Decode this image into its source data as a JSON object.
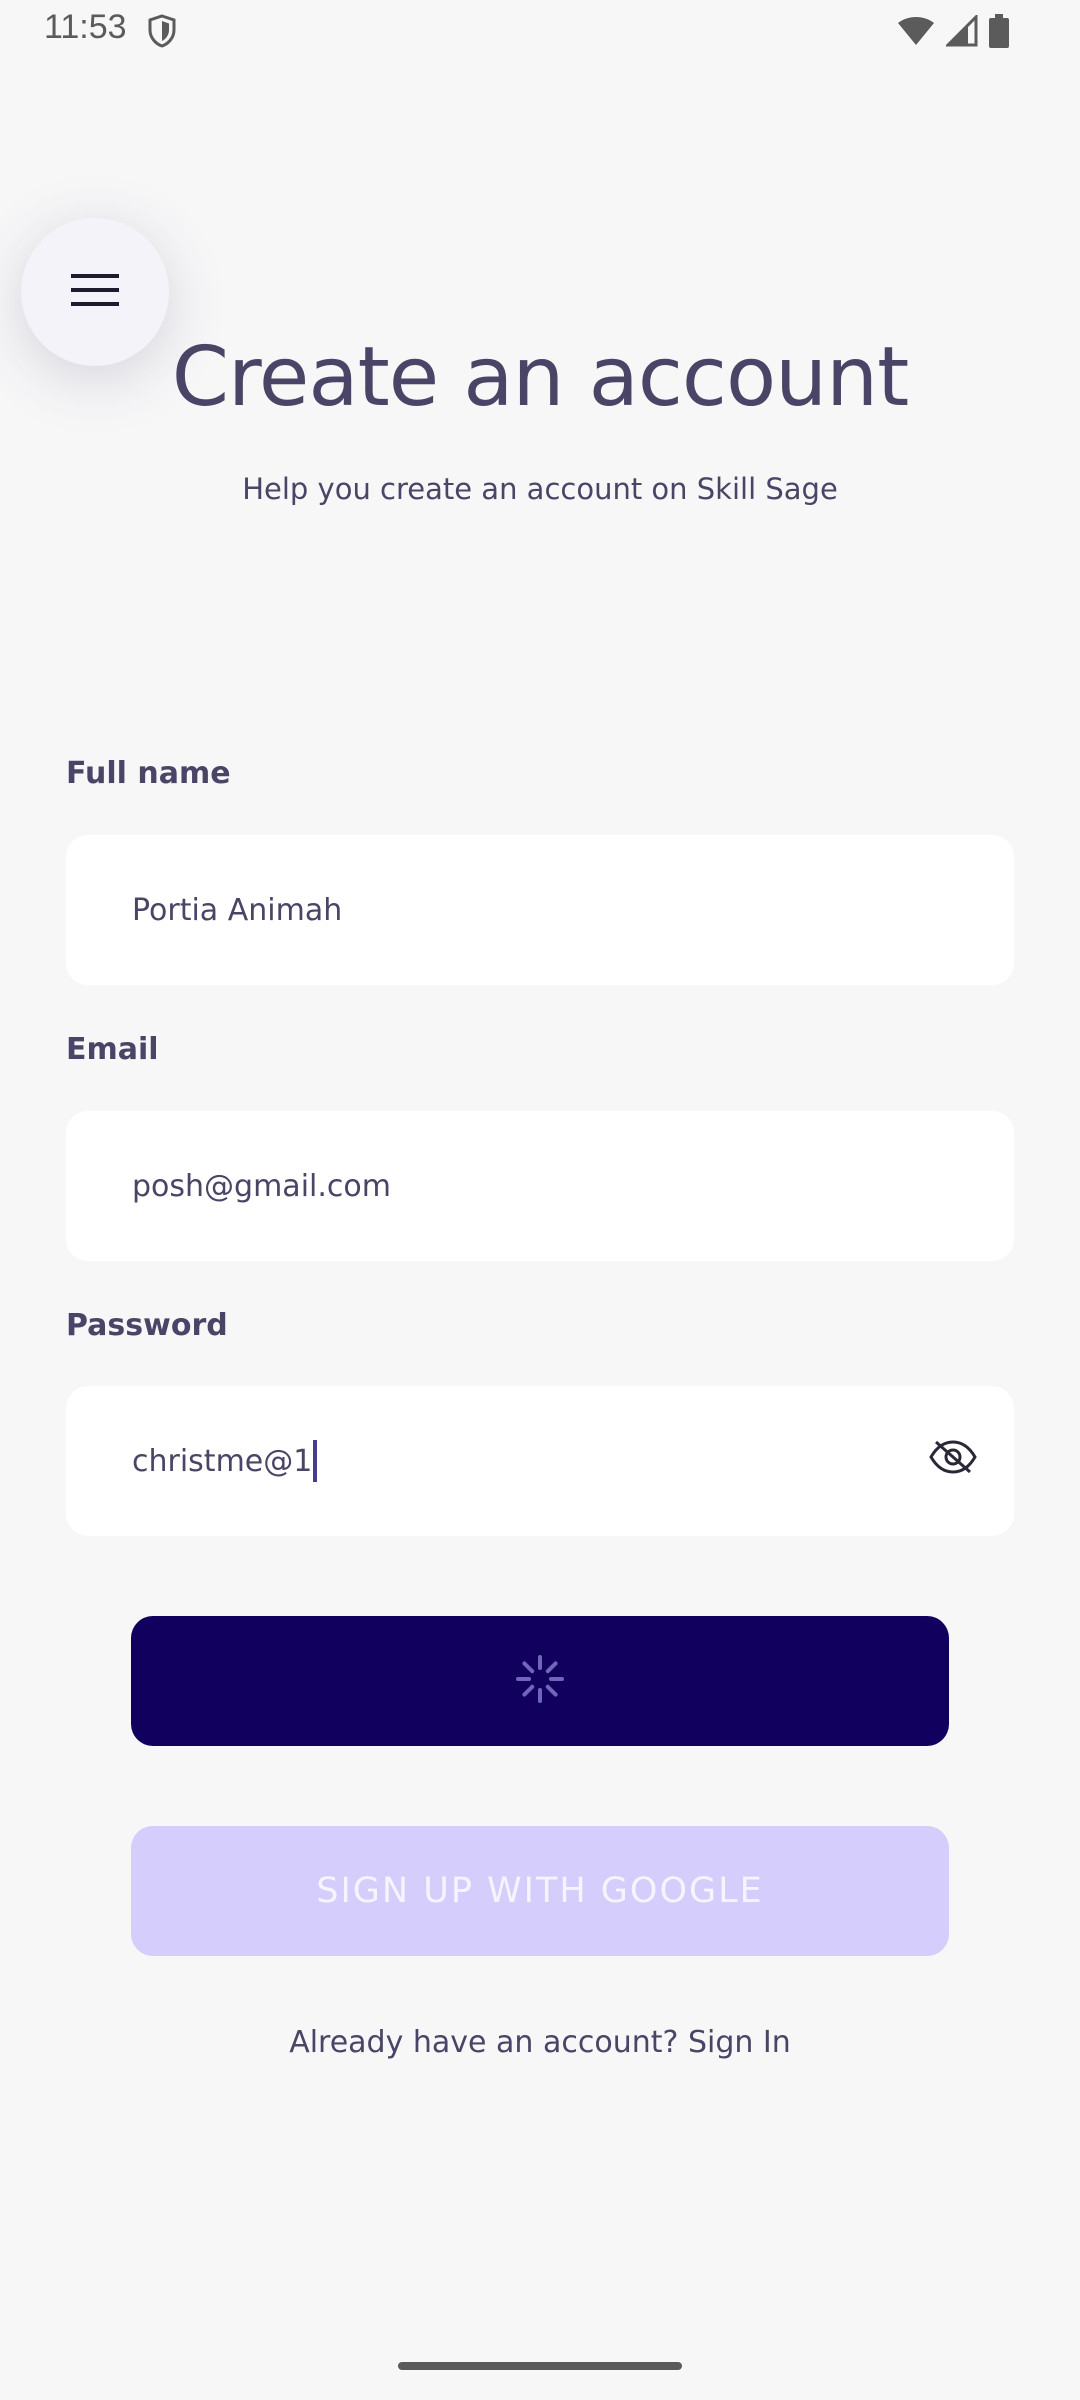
{
  "status_bar": {
    "time": "11:53",
    "icons": [
      "shield-icon",
      "wifi-icon",
      "signal-icon",
      "battery-icon"
    ]
  },
  "menu": {
    "icon": "hamburger-menu-icon"
  },
  "header": {
    "title": "Create an account",
    "subtitle": "Help you create an account on Skill Sage"
  },
  "form": {
    "full_name": {
      "label": "Full name",
      "value": "Portia Animah"
    },
    "email": {
      "label": "Email",
      "value": "posh@gmail.com"
    },
    "password": {
      "label": "Password",
      "value": "christme@1",
      "toggle_icon": "eye-off-icon"
    }
  },
  "submit_button": {
    "state": "loading",
    "icon": "loading-spinner-icon"
  },
  "google_button": {
    "label": "SIGN UP WITH GOOGLE"
  },
  "footer": {
    "prompt": "Already have an account? ",
    "link": "Sign In"
  },
  "colors": {
    "background": "#f7f7f8",
    "text": "#4a4566",
    "primary_button": "#12005e",
    "google_button": "#d5cdfb",
    "google_button_text": "#f6f4ff",
    "caret": "#4a3c8c"
  }
}
